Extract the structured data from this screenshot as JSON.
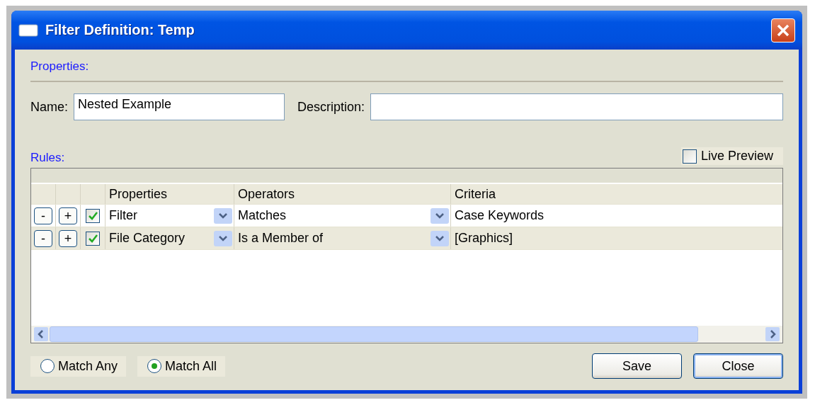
{
  "window": {
    "title": "Filter Definition: Temp"
  },
  "properties_section": {
    "heading": "Properties:",
    "name_label": "Name:",
    "name_value": "Nested Example",
    "description_label": "Description:"
  },
  "rules_section": {
    "heading": "Rules:",
    "live_preview": {
      "label": "Live Preview",
      "checked": false
    }
  },
  "table": {
    "columns": [
      "Properties",
      "Operators",
      "Criteria"
    ],
    "rows": [
      {
        "remove": "-",
        "add": "+",
        "enabled": true,
        "property": "Filter",
        "operator": "Matches",
        "criteria": "Case Keywords"
      },
      {
        "remove": "-",
        "add": "+",
        "enabled": true,
        "property": "File Category",
        "operator": "Is a Member of",
        "criteria": "[Graphics]"
      }
    ]
  },
  "match_options": [
    {
      "label": "Match Any",
      "selected": false
    },
    {
      "label": "Match All",
      "selected": true
    }
  ],
  "buttons": [
    "Save",
    "Close"
  ]
}
